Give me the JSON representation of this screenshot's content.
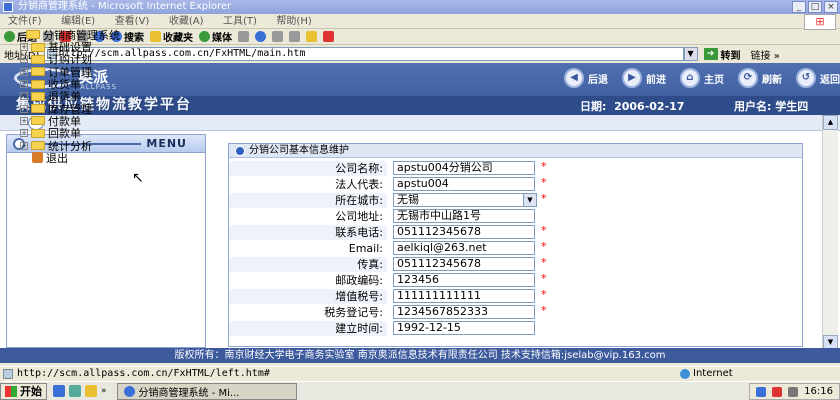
{
  "window": {
    "title": "分销商管理系统 - Microsoft Internet Explorer",
    "window_buttons": [
      "_",
      "□",
      "×"
    ]
  },
  "menubar": [
    "文件(F)",
    "编辑(E)",
    "查看(V)",
    "收藏(A)",
    "工具(T)",
    "帮助(H)"
  ],
  "toolbar": {
    "back": "后退",
    "search": "搜索",
    "favorites": "收藏夹",
    "media": "媒体"
  },
  "address": {
    "label": "地址(D)",
    "url": "http://scm.allpass.com.cn/FxHTML/main.htm",
    "go": "转到",
    "links": "链接 »"
  },
  "banner": {
    "logo_text": "奥派",
    "logo_sub": "ALLPASS",
    "platform": "集成供应链物流教学平台",
    "date_label": "日期:",
    "date": "2006-02-17",
    "user_label": "用户名:",
    "user": "学生四"
  },
  "nav_buttons": [
    {
      "label": "后退",
      "icon": "back-icon",
      "glyph": "◀"
    },
    {
      "label": "前进",
      "icon": "forward-icon",
      "glyph": "▶"
    },
    {
      "label": "主页",
      "icon": "home-icon",
      "glyph": "⌂"
    },
    {
      "label": "刷新",
      "icon": "refresh-icon",
      "glyph": "⟳"
    },
    {
      "label": "返回",
      "icon": "return-icon",
      "glyph": "↺"
    }
  ],
  "left_menu": {
    "title": "MENU",
    "root": "分销商管理系统",
    "items": [
      "基础设置",
      "订购计划",
      "订单管理",
      "收货单",
      "退货单",
      "库存管理",
      "付款单",
      "回款单",
      "统计分析"
    ],
    "exit": "退出"
  },
  "form": {
    "title": "分销公司基本信息维护",
    "fields": [
      {
        "label": "公司名称:",
        "value": "apstu004分销公司",
        "required": "*"
      },
      {
        "label": "法人代表:",
        "value": "apstu004",
        "required": "*"
      },
      {
        "label": "所在城市:",
        "value": "无锡",
        "required": "*"
      },
      {
        "label": "公司地址:",
        "value": "无锡市中山路1号",
        "required": ""
      },
      {
        "label": "联系电话:",
        "value": "051112345678",
        "required": "*"
      },
      {
        "label": "Email:",
        "value": "aelkiql@263.net",
        "required": "*"
      },
      {
        "label": "传真:",
        "value": "051112345678",
        "required": "*"
      },
      {
        "label": "邮政编码:",
        "value": "123456",
        "required": "*"
      },
      {
        "label": "增值税号:",
        "value": "111111111111",
        "required": "*"
      },
      {
        "label": "税务登记号:",
        "value": "1234567852333",
        "required": "*"
      },
      {
        "label": "建立时间:",
        "value": "1992-12-15",
        "required": ""
      }
    ]
  },
  "footer": "版权所有：南京财经大学电子商务实验室 南京奥派信息技术有限责任公司 技术支持信箱:jselab@vip.163.com",
  "statusbar": {
    "url": "http://scm.allpass.com.cn/FxHTML/left.htm#",
    "zone": "Internet"
  },
  "taskbar": {
    "start": "开始",
    "task": "分销商管理系统 - Mi...",
    "clock": "16:16"
  }
}
